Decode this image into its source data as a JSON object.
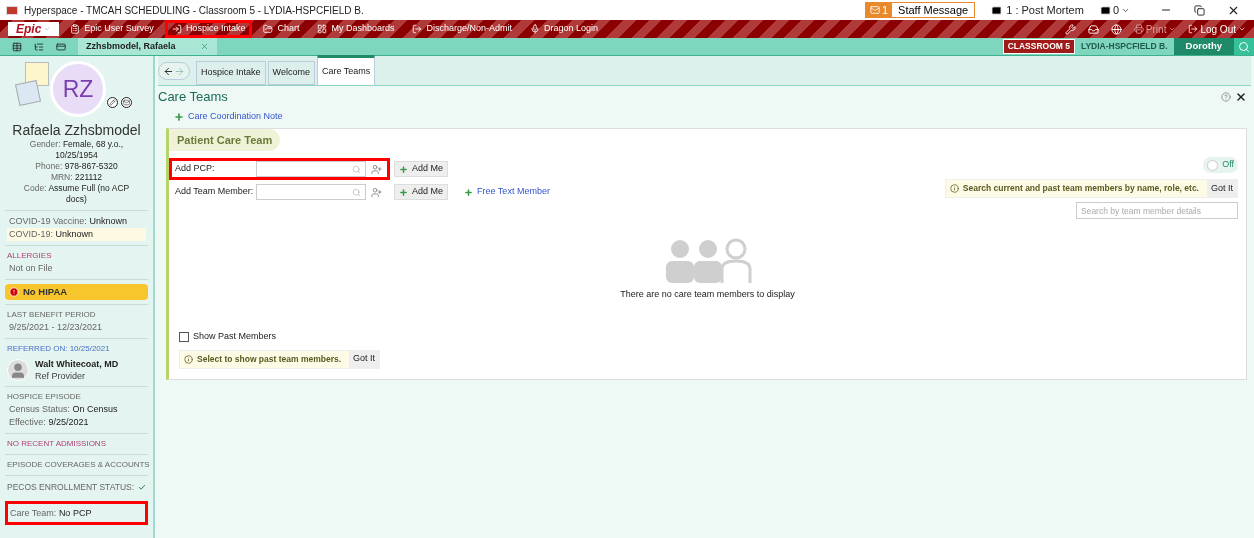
{
  "window": {
    "title": "Hyperspace - TMCAH SCHEDULING - Classroom 5 - LYDIA-HSPCFIELD B."
  },
  "messages": [
    {
      "kind": "staff",
      "count": "1",
      "label": "Staff Message"
    },
    {
      "kind": "plain",
      "label": "1 : Post Mortem"
    },
    {
      "kind": "dropdown",
      "label": "0"
    }
  ],
  "toolbar": {
    "brand": "Epic",
    "items": [
      {
        "kind": "survey",
        "label": "Epic User Survey",
        "highlighted": false
      },
      {
        "kind": "intake",
        "label": "Hospice Intake",
        "highlighted": true
      },
      {
        "kind": "chart",
        "label": "Chart",
        "highlighted": false
      },
      {
        "kind": "dashboard",
        "label": "My Dashboards",
        "highlighted": false
      },
      {
        "kind": "discharge",
        "label": "Discharge/Non-Admit",
        "highlighted": false
      },
      {
        "kind": "dragon",
        "label": "Dragon Login",
        "highlighted": false
      }
    ],
    "print": {
      "label": "Print",
      "disabled": true
    },
    "logout": {
      "label": "Log Out"
    }
  },
  "workspace_tabs": [
    {
      "label": "Zzhsbmodel, Rafaela",
      "selected": true
    }
  ],
  "context": {
    "department": "CLASSROOM 5",
    "user": "LYDIA-HSPCFIELD B.",
    "name": "Dorothy"
  },
  "patient": {
    "initials": "RZ",
    "name": "Rafaela Zzhsbmodel",
    "details": [
      {
        "label": "Gender:",
        "value": "Female, 68 y.o., 10/25/1954"
      },
      {
        "label": "Phone:",
        "value": "978-867-5320"
      },
      {
        "label": "MRN:",
        "value": "221112"
      },
      {
        "label": "Code:",
        "value": "Assume Full (no ACP docs)"
      }
    ]
  },
  "sidebar": [
    {
      "kind": "section",
      "lines": [
        {
          "label": "COVID-19 Vaccine:",
          "value": "Unknown",
          "highlighted": false
        },
        {
          "label": "COVID-19:",
          "value": "Unknown",
          "highlighted": true
        }
      ]
    },
    {
      "kind": "flag_section",
      "heading": "ALLERGIES",
      "lines": [
        {
          "label": "Not on File",
          "highlighted": false
        }
      ]
    },
    {
      "kind": "alert",
      "label": "No HIPAA"
    },
    {
      "kind": "section",
      "heading": "LAST BENEFIT PERIOD",
      "lines": [
        {
          "label": "9/25/2021 - 12/23/2021",
          "highlighted": false
        }
      ]
    },
    {
      "kind": "provider",
      "heading": "REFERRED ON: 10/25/2021",
      "name": "Walt Whitecoat, MD",
      "role": "Ref Provider"
    },
    {
      "kind": "section",
      "heading": "HOSPICE EPISODE",
      "lines": [
        {
          "label": "Census Status:",
          "value": "On Census",
          "highlighted": false
        },
        {
          "label": "Effective:",
          "value": "9/25/2021",
          "highlighted": false
        }
      ]
    },
    {
      "kind": "flag_section",
      "heading": "NO RECENT ADMISSIONS"
    },
    {
      "kind": "section",
      "heading": "EPISODE COVERAGES & ACCOUNTS"
    },
    {
      "kind": "status",
      "label": "PECOS ENROLLMENT STATUS:"
    },
    {
      "kind": "item",
      "label": "Care Team:",
      "value": "No PCP",
      "highlighted": true
    }
  ],
  "activity_tabs": [
    {
      "label": "Hospice Intake",
      "selected": false
    },
    {
      "label": "Welcome",
      "selected": false
    },
    {
      "label": "Care Teams",
      "selected": true
    }
  ],
  "page": {
    "title": "Care Teams",
    "link": "Care Coordination Note",
    "card": {
      "title": "Patient Care Team",
      "fields": [
        {
          "label": "Add PCP:",
          "button": "Add Me",
          "highlighted": true
        },
        {
          "label": "Add Team Member:",
          "button": "Add Me",
          "link": "Free Text Member",
          "highlighted": false
        }
      ],
      "toggle": {
        "label": "Off",
        "on": false
      },
      "search_tip": {
        "text": "Search current and past team members by name, role, etc.",
        "button": "Got It"
      },
      "search": {
        "placeholder": "Search by team member details"
      },
      "empty_message": "There are no care team members to display",
      "show_past": {
        "label": "Show Past Members",
        "checked": false
      },
      "past_tip": {
        "text": "Select to show past team members.",
        "button": "Got It"
      }
    }
  }
}
